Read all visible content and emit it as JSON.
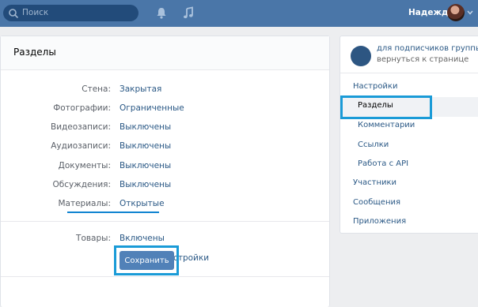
{
  "topbar": {
    "search_placeholder": "Поиск",
    "user_name": "Надежда"
  },
  "main": {
    "title": "Разделы",
    "rows": [
      {
        "label": "Стена:",
        "value": "Закрытая"
      },
      {
        "label": "Фотографии:",
        "value": "Ограниченные"
      },
      {
        "label": "Видеозаписи:",
        "value": "Выключены"
      },
      {
        "label": "Аудиозаписи:",
        "value": "Выключены"
      },
      {
        "label": "Документы:",
        "value": "Выключены"
      },
      {
        "label": "Обсуждения:",
        "value": "Выключены"
      },
      {
        "label": "Материалы:",
        "value": "Открытые"
      }
    ],
    "goods": {
      "label": "Товары:",
      "value": "Включены"
    },
    "show_settings": "Показать настройки",
    "save_label": "Сохранить"
  },
  "side": {
    "group_name": "для подписчиков группы...",
    "back_link": "вернуться к странице",
    "menu": {
      "settings": "Настройки",
      "sections": "Разделы",
      "comments": "Комментарии",
      "links": "Ссылки",
      "api": "Работа с API",
      "members": "Участники",
      "messages": "Сообщения",
      "apps": "Приложения"
    }
  },
  "colors": {
    "header": "#4a76a8",
    "accent_link": "#2a5885",
    "button": "#5181b8",
    "annotation": "#1a9bd7"
  }
}
